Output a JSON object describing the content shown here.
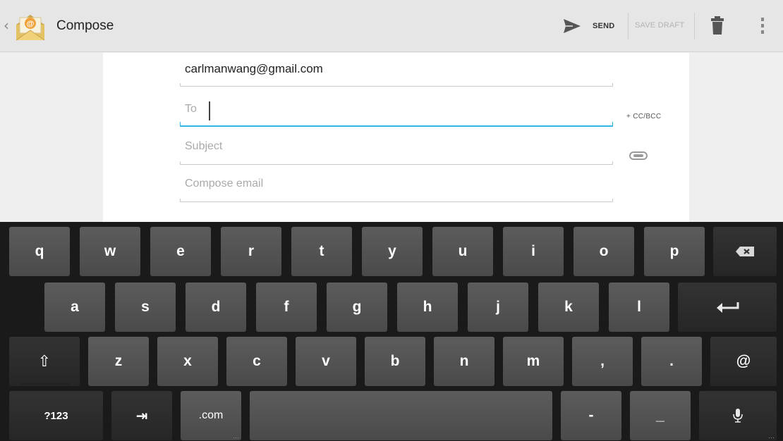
{
  "actionbar": {
    "title": "Compose",
    "send_label": "SEND",
    "save_draft_label": "SAVE DRAFT",
    "up_glyph": "‹"
  },
  "compose": {
    "from": "carlmanwang@gmail.com",
    "to_placeholder": "To",
    "subject_placeholder": "Subject",
    "body_placeholder": "Compose email",
    "cc_bcc_label": "+ CC/BCC"
  },
  "keyboard": {
    "row1": [
      "q",
      "w",
      "e",
      "r",
      "t",
      "y",
      "u",
      "i",
      "o",
      "p"
    ],
    "row2": [
      "a",
      "s",
      "d",
      "f",
      "g",
      "h",
      "j",
      "k",
      "l"
    ],
    "row3": [
      "z",
      "x",
      "c",
      "v",
      "b",
      "n",
      "m",
      ",",
      "."
    ],
    "at": "@",
    "shift_glyph": "⇧",
    "symbols": "?123",
    "tab_glyph": "⇥",
    "dotcom": ".com",
    "dash": "-",
    "underscore": "_",
    "enter_glyph": "↵"
  },
  "colors": {
    "accent": "#33b5e5",
    "keyboard_bg": "#1a1a1a",
    "key_bg": "#4f4f4f"
  }
}
